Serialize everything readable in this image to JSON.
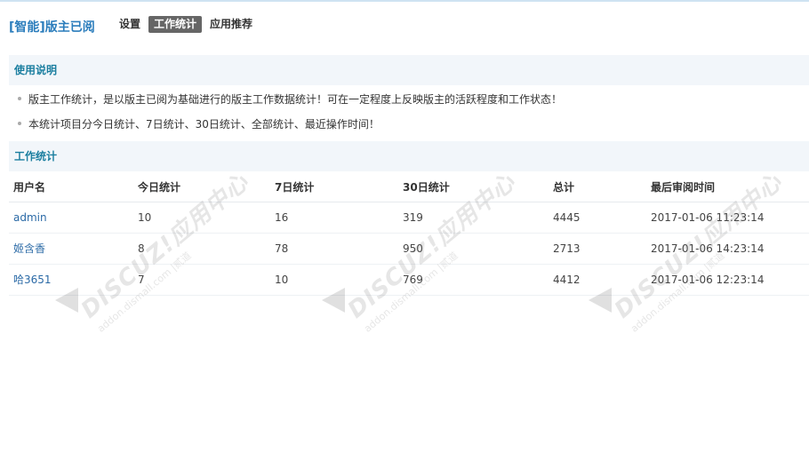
{
  "header": {
    "title": "[智能]版主已阅",
    "nav": [
      {
        "label": "设置",
        "active": false
      },
      {
        "label": "工作统计",
        "active": true
      },
      {
        "label": "应用推荐",
        "active": false
      }
    ]
  },
  "usage": {
    "heading": "使用说明",
    "lines": [
      "版主工作统计，是以版主已阅为基础进行的版主工作数据统计！可在一定程度上反映版主的活跃程度和工作状态！",
      "本统计项目分今日统计、7日统计、30日统计、全部统计、最近操作时间！"
    ]
  },
  "stats": {
    "heading": "工作统计",
    "columns": [
      "用户名",
      "今日统计",
      "7日统计",
      "30日统计",
      "总计",
      "最后审阅时间"
    ],
    "rows": [
      {
        "user": "admin",
        "today": "10",
        "week": "16",
        "month": "319",
        "total": "4445",
        "last": "2017-01-06 11:23:14"
      },
      {
        "user": "姬含香",
        "today": "8",
        "week": "78",
        "month": "950",
        "total": "2713",
        "last": "2017-01-06 14:23:14"
      },
      {
        "user": "哈3651",
        "today": "7",
        "week": "10",
        "month": "769",
        "total": "4412",
        "last": "2017-01-06 12:23:14"
      }
    ]
  },
  "watermark": {
    "logo": "DISCUZ!应用中心",
    "sub": "addon.dismall.com",
    "brand": "|贰道"
  },
  "colors": {
    "title": "#2b7dbc",
    "section_heading": "#1c7fa0",
    "section_bg": "#f2f6fa",
    "active_tab_bg": "#666666",
    "link": "#2b6aa6"
  }
}
